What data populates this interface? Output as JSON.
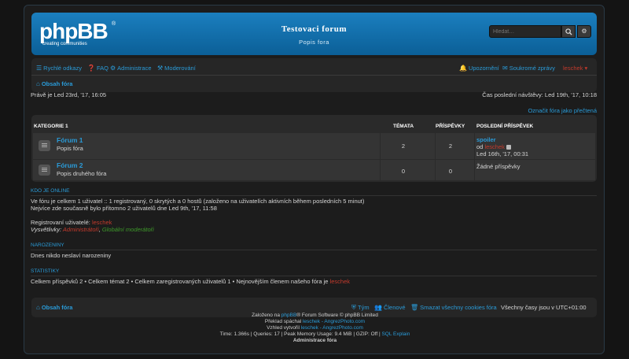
{
  "header": {
    "logo_text": "phpBB",
    "logo_sub": "creating communities",
    "logo_reg": "®",
    "site_title": "Testovaci forum",
    "site_desc": "Popis fora",
    "search_placeholder": "Hledat…"
  },
  "navbar": {
    "quick_links": "Rychlé odkazy",
    "faq": "FAQ",
    "admin": "Administrace",
    "moderate": "Moderování",
    "notifications": "Upozornění",
    "pm": "Soukromé zprávy",
    "user": "leschek",
    "breadcrumb": "Obsah fóra"
  },
  "info": {
    "current_time": "Právě je Led 23rd, '17, 16:05",
    "last_visit": "Čas poslední návštěvy: Led 19th, '17, 10:18",
    "mark_read": "Označit fóra jako přečtená"
  },
  "forum_table": {
    "headers": {
      "category": "KATEGORIE 1",
      "topics": "TÉMATA",
      "posts": "PŘÍSPĚVKY",
      "last_post": "POSLEDNÍ PŘÍSPĚVEK"
    },
    "rows": [
      {
        "name": "Fórum 1",
        "desc": "Popis fóra",
        "topics": "2",
        "posts": "2",
        "last_title": "spoiler",
        "last_by_prefix": "od",
        "last_by": "leschek",
        "last_date": "Led 16th, '17, 00:31"
      },
      {
        "name": "Fórum 2",
        "desc": "Popis druhého fóra",
        "topics": "0",
        "posts": "0",
        "last_none": "Žádné příspěvky"
      }
    ]
  },
  "online": {
    "title": "KDO JE ONLINE",
    "line1": "Ve fóru je celkem 1 uživatel :: 1 registrovaný, 0 skrytých a 0 hostů (založeno na uživatelích aktivních během posledních 5 minut)",
    "line2": "Nejvíce zde současně bylo přítomno 2 uživatelů dne Led 9th, '17, 11:58",
    "registered_label": "Registrovaní uživatelé:",
    "registered_user": "leschek",
    "legend_label": "Vysvětlivky:",
    "legend_admin": "Administrátoři",
    "legend_sep": ",",
    "legend_mod": "Globální moderátoři"
  },
  "birthdays": {
    "title": "NAROZENINY",
    "text": "Dnes nikdo neslaví narozeniny"
  },
  "stats": {
    "title": "STATISTIKY",
    "text": "Celkem příspěvků 2 • Celkem témat 2 • Celkem zaregistrovaných uživatelů 1 • Nejnovějším členem našeho fóra je",
    "newest": "leschek"
  },
  "footer_nav": {
    "home": "Obsah fóra",
    "team": "Tým",
    "members": "Členové",
    "cookies": "Smazat všechny cookies fóra",
    "timezone": "Všechny časy jsou v UTC+01:00"
  },
  "copyright": {
    "line1_pre": "Založeno na",
    "line1_link": "phpBB",
    "line1_post": "® Forum Software © phpBB Limited",
    "line2_pre": "Překlad spáchal",
    "line2_link": "leschek - AngrezPhoto.com",
    "line3_pre": "Vzhled vytvořil",
    "line3_link": "leschek - AngrezPhoto.com",
    "line4": "Time: 1.366s | Queries: 17 | Peak Memory Usage: 9.4 MiB | GZIP: Off |",
    "line4_link": "SQL Explain",
    "line5": "Administrace fóra"
  },
  "colors": {
    "accent": "#2a9bd8",
    "header": "#0f6fae",
    "admin_red": "#c23a2c",
    "mod_green": "#3e9a2a"
  }
}
